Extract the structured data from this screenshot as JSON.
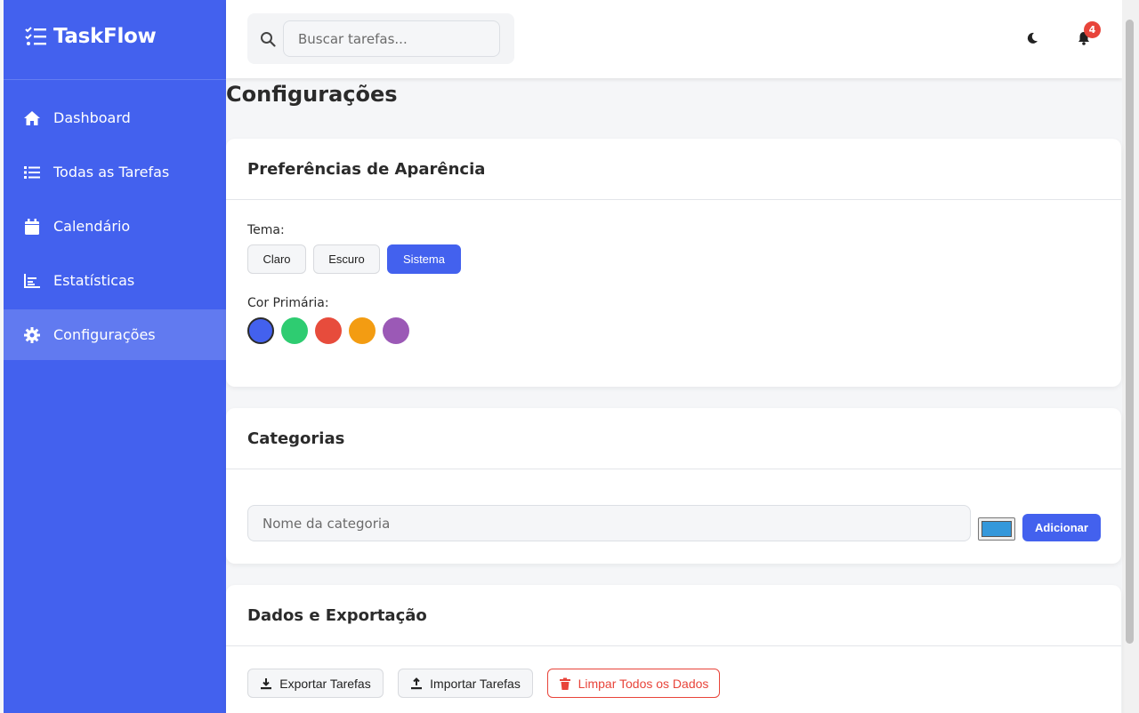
{
  "app": {
    "name": "TaskFlow"
  },
  "sidebar": {
    "items": [
      {
        "label": "Dashboard",
        "icon": "home-icon",
        "active": false
      },
      {
        "label": "Todas as Tarefas",
        "icon": "list-icon",
        "active": false
      },
      {
        "label": "Calendário",
        "icon": "calendar-icon",
        "active": false
      },
      {
        "label": "Estatísticas",
        "icon": "chart-icon",
        "active": false
      },
      {
        "label": "Configurações",
        "icon": "gear-icon",
        "active": true
      }
    ]
  },
  "topbar": {
    "search_placeholder": "Buscar tarefas...",
    "notification_count": "4"
  },
  "page": {
    "title": "Configurações"
  },
  "appearance": {
    "title": "Preferências de Aparência",
    "theme_label": "Tema:",
    "themes": [
      "Claro",
      "Escuro",
      "Sistema"
    ],
    "selected_theme": "Sistema",
    "color_label": "Cor Primária:",
    "colors": [
      "#4361ee",
      "#2ecc71",
      "#e74c3c",
      "#f39c12",
      "#9b59b6"
    ],
    "selected_color": "#4361ee"
  },
  "categories": {
    "title": "Categorias",
    "input_placeholder": "Nome da categoria",
    "color_value": "#3498db",
    "add_label": "Adicionar"
  },
  "data_export": {
    "title": "Dados e Exportação",
    "export_label": "Exportar Tarefas",
    "import_label": "Importar Tarefas",
    "clear_label": "Limpar Todos os Dados"
  },
  "colors": {
    "brand": "#4361ee",
    "danger": "#e8443a"
  }
}
